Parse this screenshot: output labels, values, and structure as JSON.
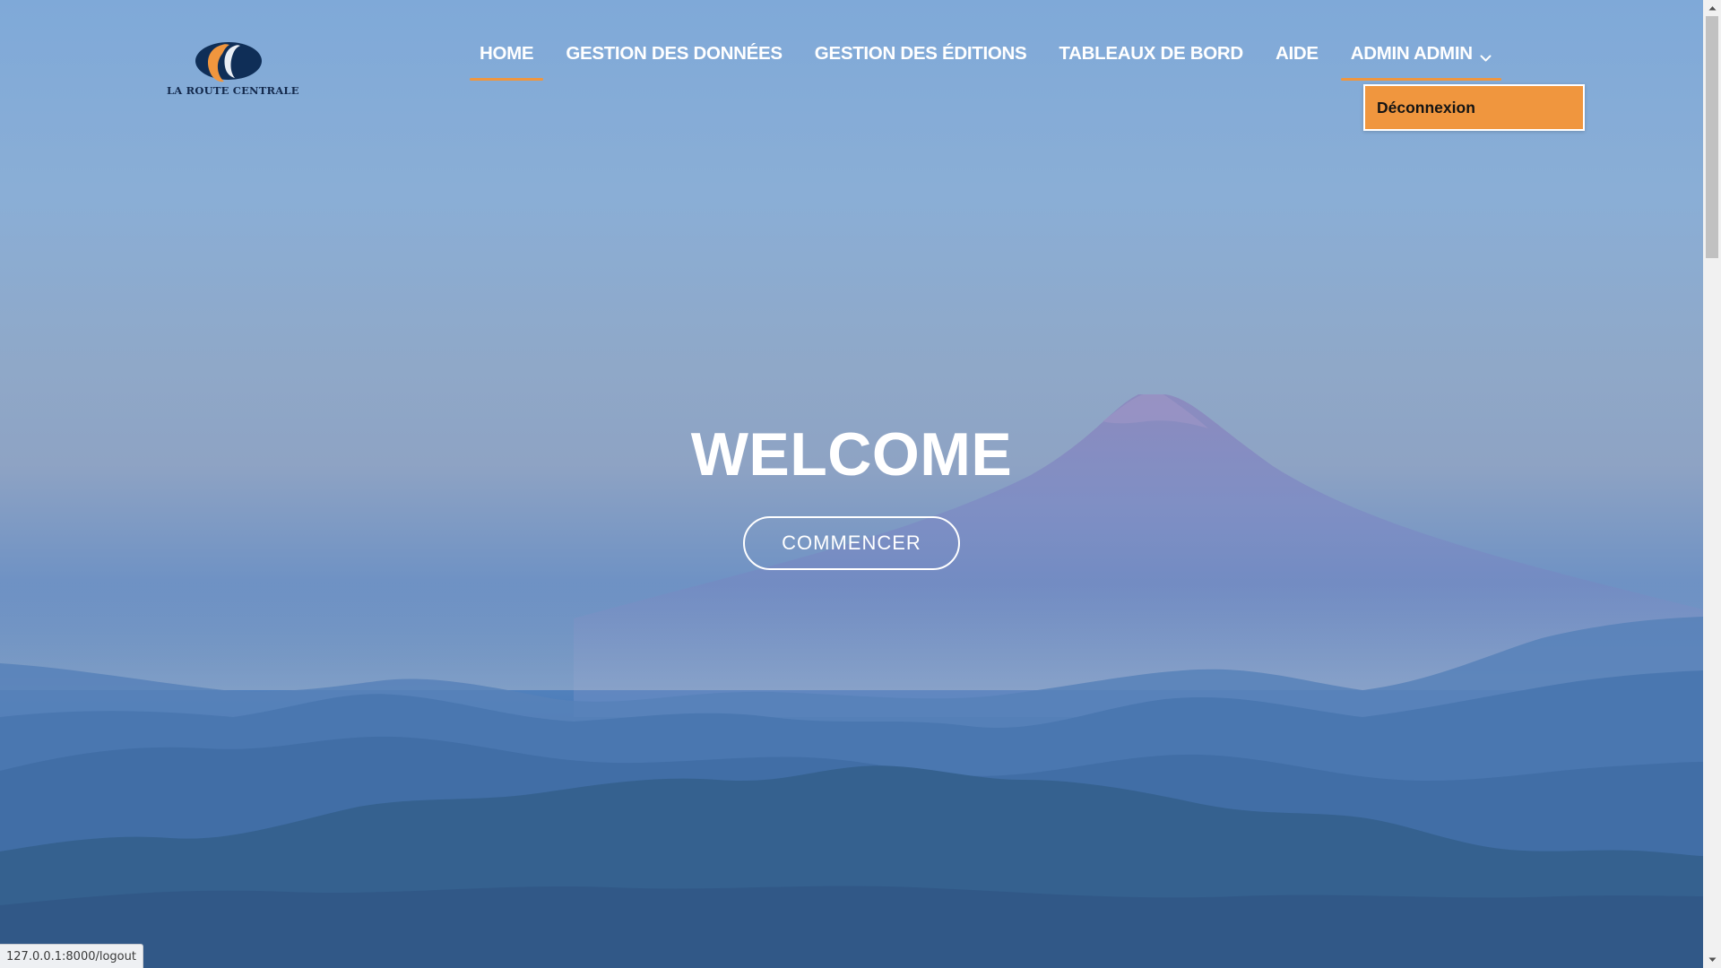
{
  "logo": {
    "text": "LA ROUTE CENTRALE"
  },
  "nav": {
    "items": [
      {
        "label": "HOME",
        "active": true
      },
      {
        "label": "GESTION DES DONNÉES"
      },
      {
        "label": "GESTION DES ÉDITIONS"
      },
      {
        "label": "TABLEAUX DE BORD"
      },
      {
        "label": "AIDE"
      }
    ],
    "user_menu": {
      "label": "ADMIN ADMIN",
      "icon": "chevron-down-icon",
      "open": true,
      "items": [
        "Déconnexion"
      ]
    }
  },
  "hero": {
    "title": "WELCOME",
    "button_label": "COMMENCER"
  },
  "status_bar": {
    "url": "127.0.0.1:8000/logout"
  },
  "colors": {
    "accent": "#f0963e",
    "text_light": "#ffffff",
    "logo_navy": "#142a4d"
  }
}
